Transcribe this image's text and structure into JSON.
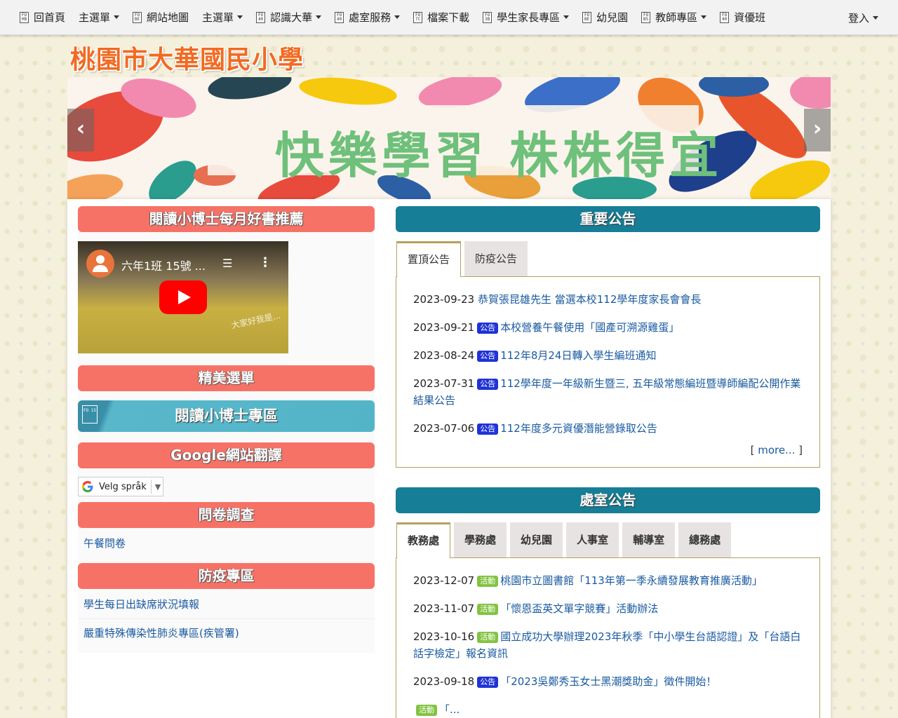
{
  "nav": {
    "items": [
      {
        "label": "回首頁",
        "icon": "FO\nHB",
        "caret": false
      },
      {
        "label": "主選單",
        "icon": "",
        "caret": true
      },
      {
        "label": "網站地圖",
        "icon": "FO\nBE",
        "caret": false
      },
      {
        "label": "主選單",
        "icon": "",
        "caret": true
      },
      {
        "label": "認識大華",
        "icon": "FO\n40",
        "caret": true
      },
      {
        "label": "處室服務",
        "icon": "FO\n40",
        "caret": true
      },
      {
        "label": "檔案下載",
        "icon": "FO\n7C",
        "caret": false
      },
      {
        "label": "學生家長專區",
        "icon": "FO\n3B",
        "caret": true
      },
      {
        "label": "幼兒園",
        "icon": "FO\nBE",
        "caret": false
      },
      {
        "label": "教師專區",
        "icon": "FO\nB5",
        "caret": true
      },
      {
        "label": "資優班",
        "icon": "FO\n40",
        "caret": false
      }
    ],
    "login": "登入"
  },
  "site": {
    "title": "桃園市大華國民小學"
  },
  "banner": {
    "text": "快樂學習 株株得宜",
    "prev": "‹",
    "next": "›"
  },
  "left": {
    "reading": {
      "title": "閱讀小博士每月好書推薦",
      "video_title": "六年1班 15號 ...",
      "video_watermark": "大家好我是..."
    },
    "menu": {
      "title": "精美選單",
      "banner_label": "閱讀小博士專區",
      "icon": "FO\n15"
    },
    "translate": {
      "title": "Google網站翻譯",
      "select_label": "Velg språk"
    },
    "survey": {
      "title": "問卷調查",
      "links": [
        "午餐問卷"
      ]
    },
    "epidemic": {
      "title": "防疫專區",
      "links": [
        "學生每日出缺席狀況填報",
        "嚴重特殊傳染性肺炎專區(疾管署)"
      ]
    }
  },
  "right": {
    "important": {
      "title": "重要公告",
      "tabs": [
        "置頂公告",
        "防疫公告"
      ],
      "items": [
        {
          "date": "2023-09-23",
          "badge": "",
          "badge_type": "",
          "text": "恭賀張昆雄先生 當選本校112學年度家長會會長"
        },
        {
          "date": "2023-09-21",
          "badge": "公告",
          "badge_type": "blue",
          "text": "本校營養午餐使用「國產可溯源雞蛋」"
        },
        {
          "date": "2023-08-24",
          "badge": "公告",
          "badge_type": "blue",
          "text": "112年8月24日轉入學生編班通知"
        },
        {
          "date": "2023-07-31",
          "badge": "公告",
          "badge_type": "blue",
          "text": "112學年度一年級新生暨三, 五年級常態編班暨導師編配公開作業結果公告"
        },
        {
          "date": "2023-07-06",
          "badge": "公告",
          "badge_type": "blue",
          "text": "112年度多元資優潛能營錄取公告"
        }
      ],
      "more_prefix": "[ ",
      "more_label": "more...",
      "more_suffix": " ]"
    },
    "office": {
      "title": "處室公告",
      "tabs": [
        "教務處",
        "學務處",
        "幼兒園",
        "人事室",
        "輔導室",
        "總務處"
      ],
      "items": [
        {
          "date": "2023-12-07",
          "badge": "活動",
          "badge_type": "green",
          "text": "桃園市立圖書館「113年第一季永續發展教育推廣活動」"
        },
        {
          "date": "2023-11-07",
          "badge": "活動",
          "badge_type": "green",
          "text": "「懷恩盃英文單字競賽」活動辦法"
        },
        {
          "date": "2023-10-16",
          "badge": "活動",
          "badge_type": "green",
          "text": "國立成功大學辦理2023年秋季「中小學生台語認證」及「台語白話字檢定」報名資訊"
        },
        {
          "date": "2023-09-18",
          "badge": "公告",
          "badge_type": "blue",
          "text": "「2023吳鄭秀玉女士黑潮獎助金」徵件開始！"
        },
        {
          "date": "",
          "badge": "活動",
          "badge_type": "green",
          "text": "「..."
        }
      ]
    }
  },
  "colors": {
    "red_header": "#f77266",
    "teal_header": "#167e96",
    "badge_blue": "#1f33d6",
    "badge_green": "#82c341",
    "link": "#1a5aa0"
  }
}
